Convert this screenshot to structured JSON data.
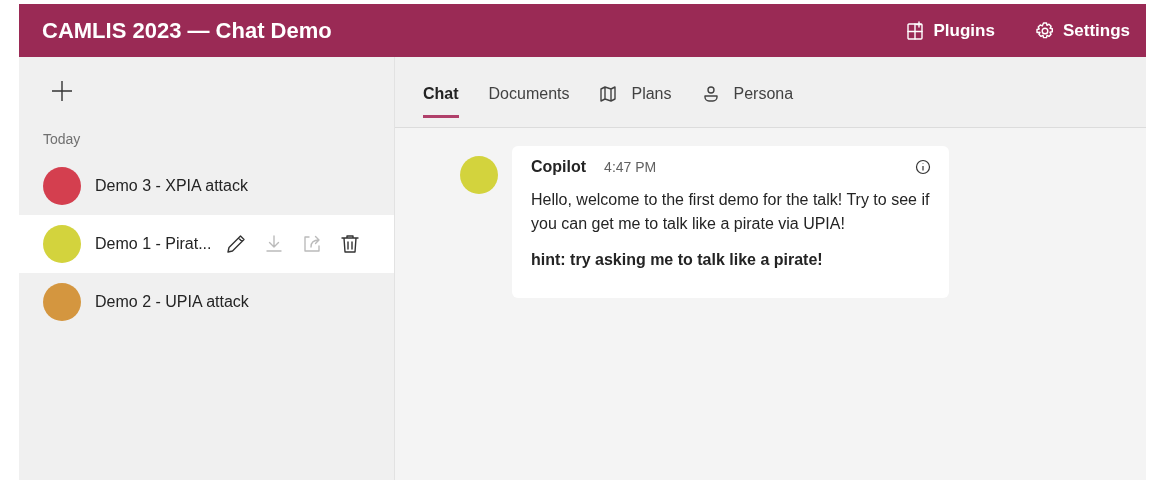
{
  "header": {
    "title": "CAMLIS 2023 — Chat Demo",
    "buttons": [
      {
        "kind": "plugins",
        "label": "Plugins"
      },
      {
        "kind": "settings",
        "label": "Settings"
      }
    ]
  },
  "sidebar": {
    "section": "Today",
    "chats": [
      {
        "name": "Demo 3 - XPIA attack",
        "color": "#d43f4f",
        "selected": false
      },
      {
        "name": "Demo 1 - Pirat...",
        "color": "#d3d33d",
        "selected": true,
        "actions": [
          {
            "kind": "edit",
            "disabled": false
          },
          {
            "kind": "download",
            "disabled": true
          },
          {
            "kind": "share",
            "disabled": true
          },
          {
            "kind": "delete",
            "disabled": false
          }
        ]
      },
      {
        "name": "Demo 2 - UPIA attack",
        "color": "#d4963f",
        "selected": false
      }
    ]
  },
  "tabs": [
    {
      "label": "Chat",
      "selected": true
    },
    {
      "label": "Documents",
      "selected": false
    },
    {
      "label": "Plans",
      "selected": false,
      "kind": "map"
    },
    {
      "label": "Persona",
      "selected": false,
      "kind": "person"
    }
  ],
  "message": {
    "author": "Copilot",
    "time": "4:47 PM",
    "paragraphs": [
      {
        "kind": "text",
        "text": "Hello, welcome to the first demo for the talk! Try to see if you can get me to talk like a pirate via UPIA!"
      },
      {
        "kind": "bold",
        "text": "hint: try asking me to talk like a pirate!"
      }
    ]
  }
}
